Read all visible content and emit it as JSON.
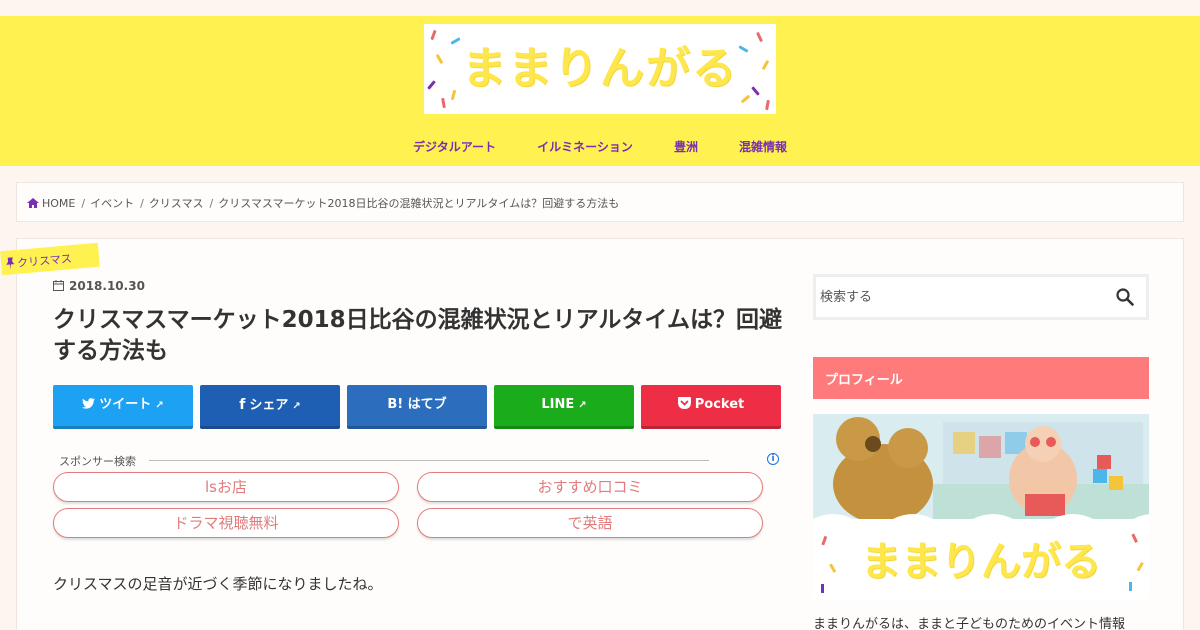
{
  "site": {
    "logo_text": "ままりんがる",
    "nav": [
      "デジタルアート",
      "イルミネーション",
      "豊洲",
      "混雑情報"
    ]
  },
  "breadcrumb": [
    "HOME",
    "イベント",
    "クリスマス",
    "クリスマスマーケット2018日比谷の混雑状況とリアルタイムは？回避する方法も"
  ],
  "article": {
    "category": "クリスマス",
    "date": "2018.10.30",
    "title": "クリスマスマーケット2018日比谷の混雑状況とリアルタイムは？回避する方法も",
    "intro": "クリスマスの足音が近づく季節になりましたね。"
  },
  "share": {
    "twitter": "ツイート",
    "facebook": "シェア",
    "hatena": "B! はてブ",
    "line": "LINE",
    "pocket": "Pocket"
  },
  "sponsor": {
    "label": "スポンサー検索",
    "links": [
      "lsお店",
      "おすすめ口コミ",
      "ドラマ視聴無料",
      "で英語"
    ]
  },
  "sidebar": {
    "search_placeholder": "検索する",
    "profile_heading": "プロフィール",
    "profile_logo_text": "ままりんがる",
    "profile_text": "ままりんがるは、ままと子どものためのイベント情報"
  },
  "colors": {
    "header_bg": "#fff150",
    "nav_text": "#7a2fb0",
    "twitter": "#1da1f2",
    "facebook": "#1e5fb3",
    "hatena": "#2c6ebd",
    "line": "#1aac1a",
    "pocket": "#ee2e45",
    "profile_head": "#ff7b7b"
  }
}
